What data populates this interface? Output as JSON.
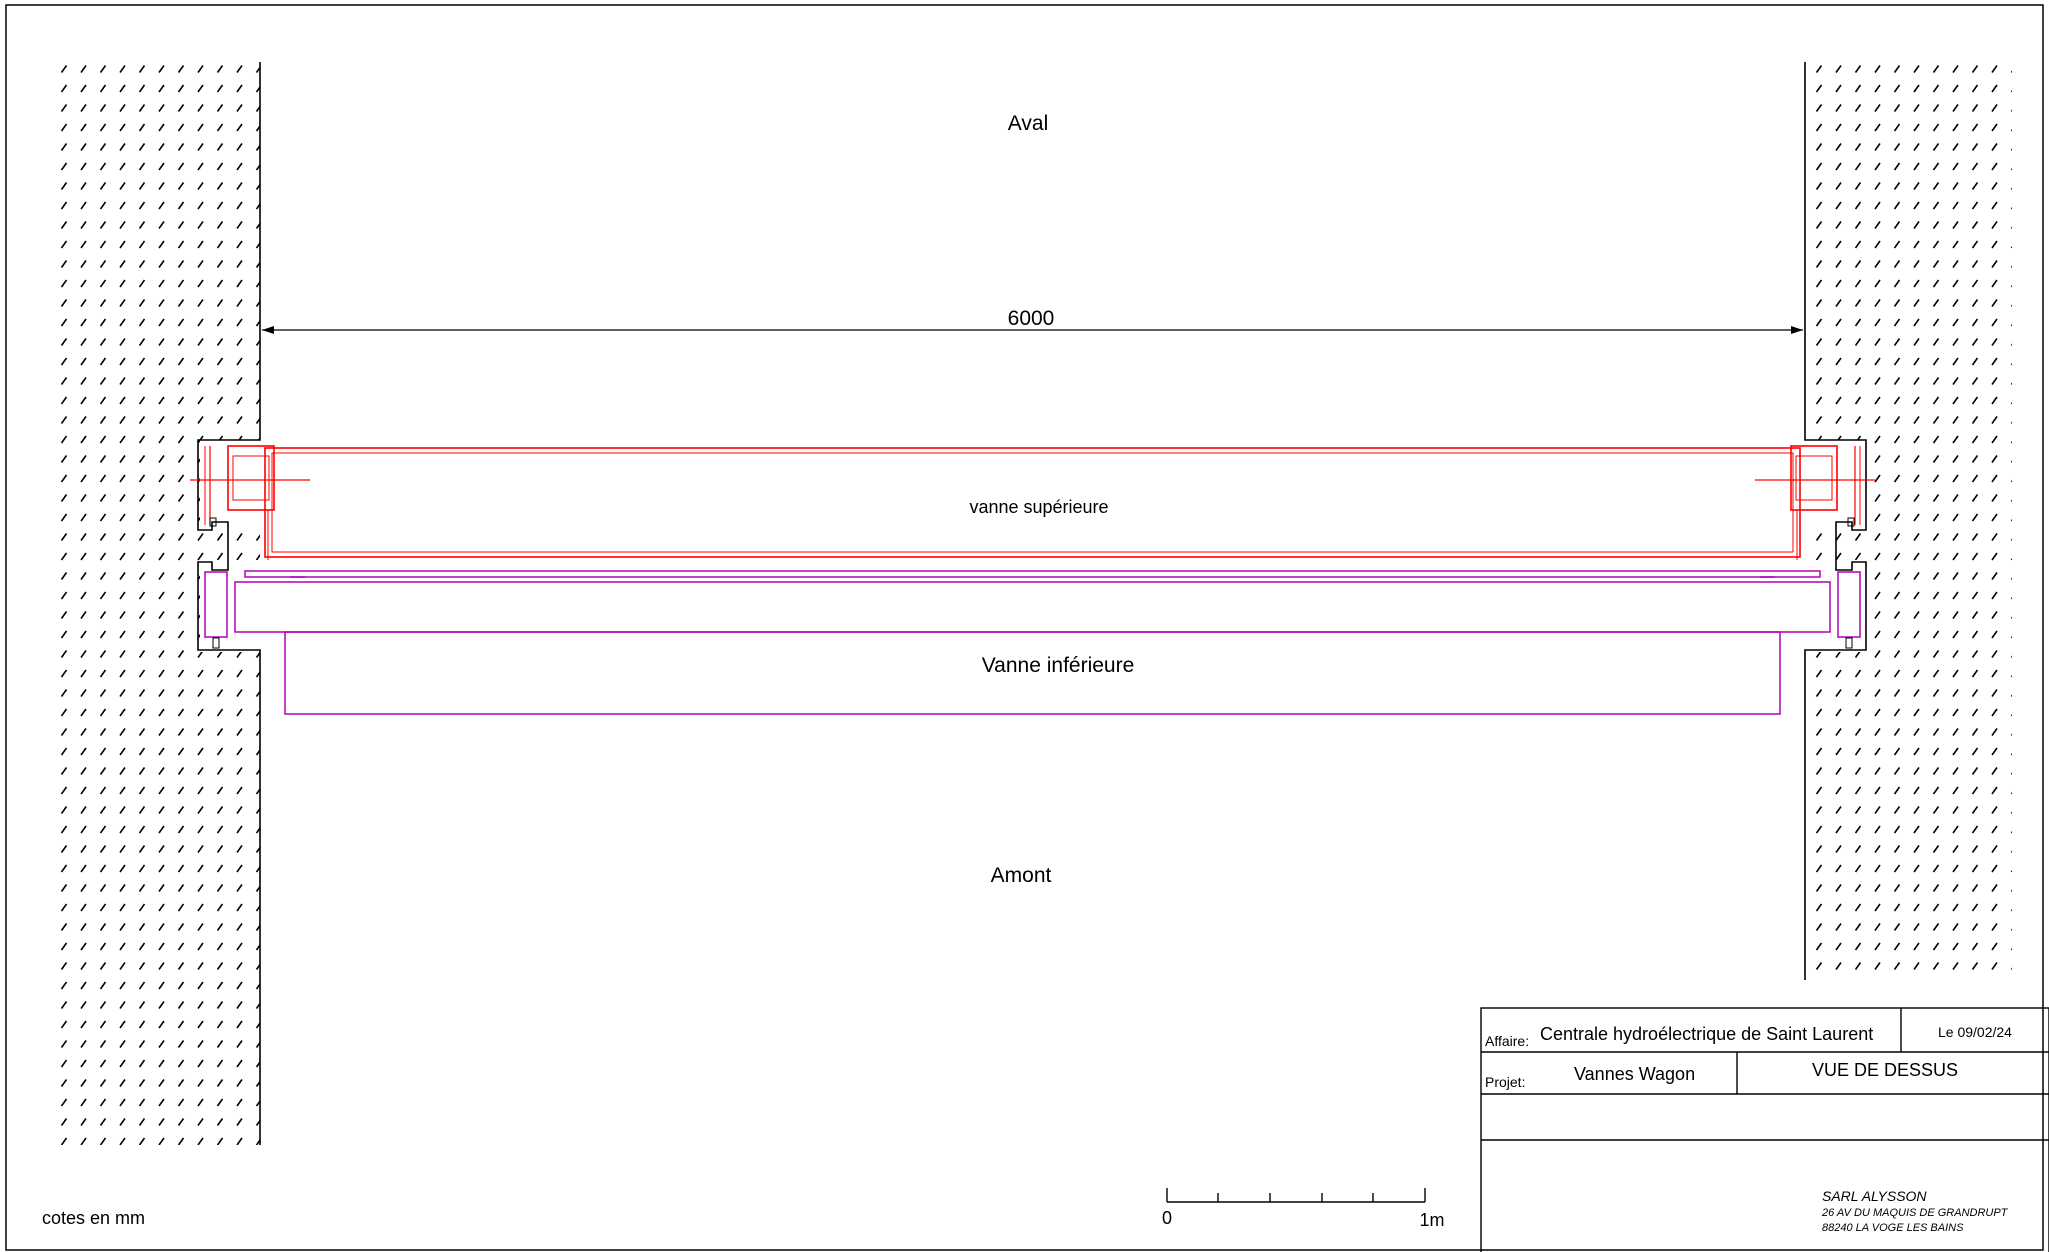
{
  "orientation": {
    "downstream": "Aval",
    "upstream": "Amont"
  },
  "dimension": {
    "span": "6000"
  },
  "gates": {
    "upper": "vanne supérieure",
    "lower": "Vanne inférieure"
  },
  "units_note": "cotes en mm",
  "scale_bar": {
    "start": "0",
    "end": "1m"
  },
  "title_block": {
    "affaire_label": "Affaire:",
    "affaire_value": "Centrale hydroélectrique de Saint Laurent",
    "date": "Le 09/02/24",
    "projet_label": "Projet:",
    "projet_value": "Vannes Wagon",
    "view": "VUE DE DESSUS",
    "company": "SARL ALYSSON",
    "address_1": "26 AV DU MAQUIS DE GRANDRUPT",
    "address_2": "88240 LA VOGE LES BAINS"
  },
  "colors": {
    "upper_gate": "#ff0000",
    "lower_gate": "#b000b0",
    "lines": "#000000"
  }
}
